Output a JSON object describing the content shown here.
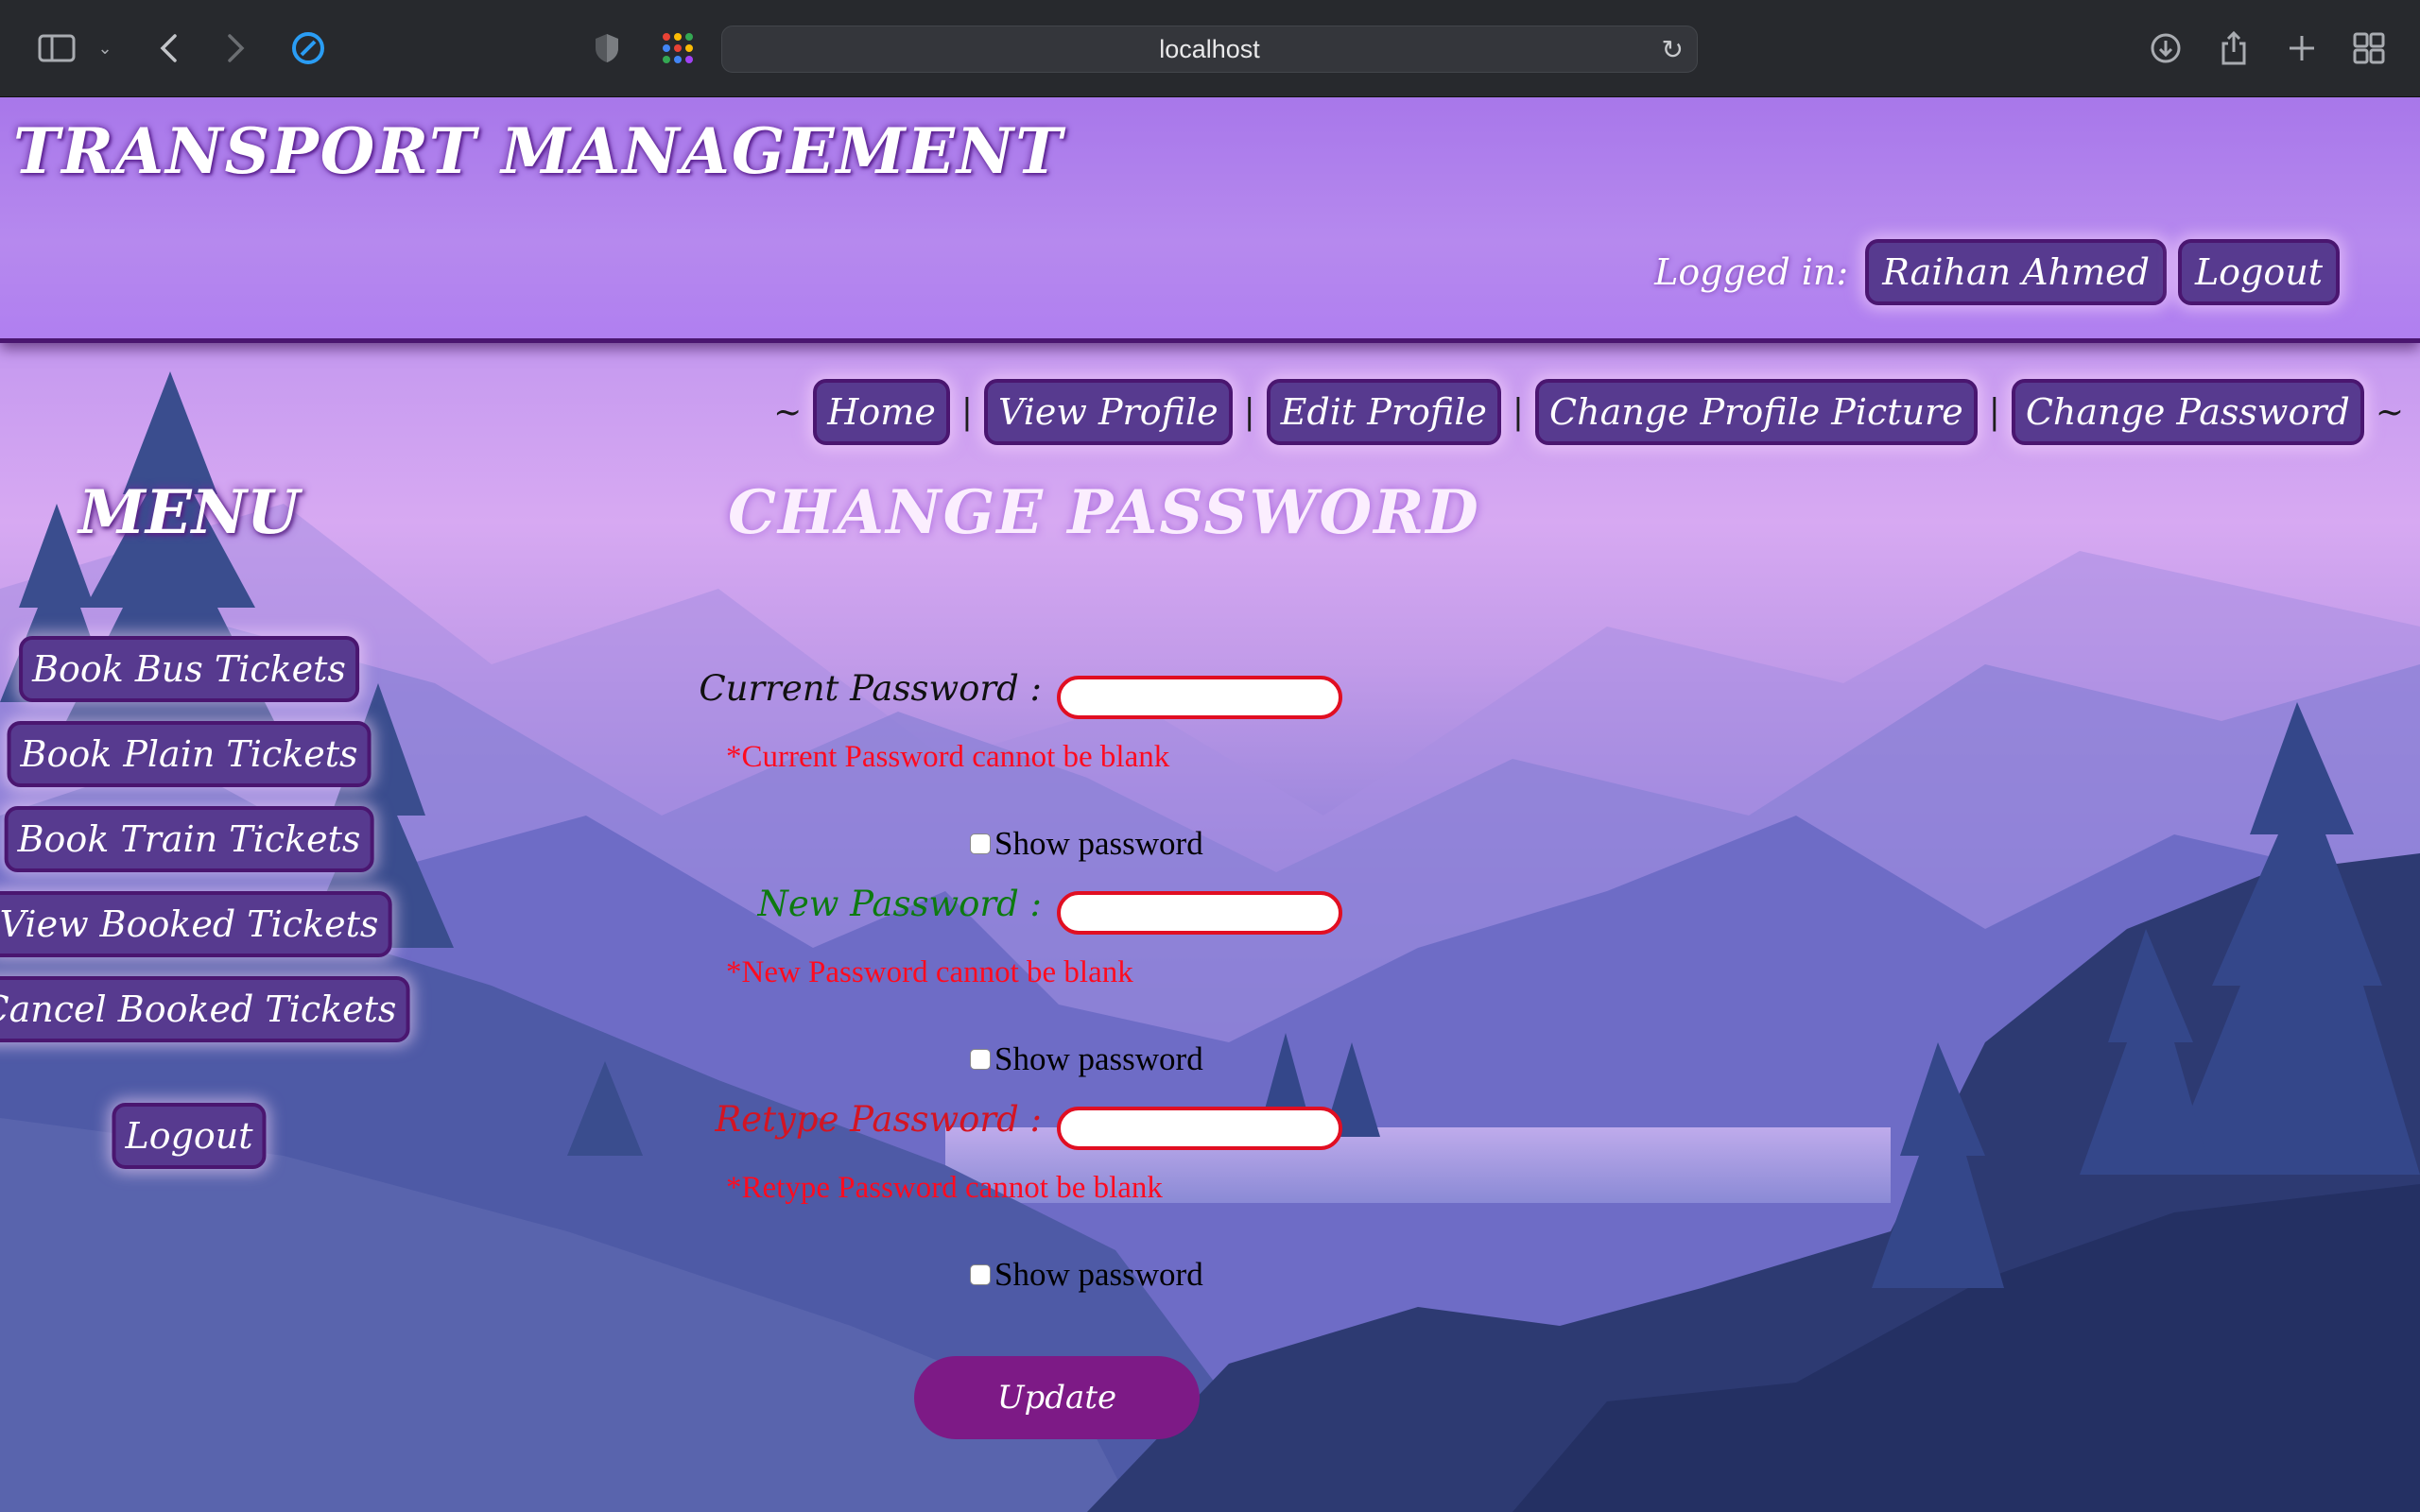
{
  "browser": {
    "url": "localhost"
  },
  "header": {
    "title": "TRANSPORT MANAGEMENT",
    "logged_in_label": "Logged in:",
    "user_name": "Raihan Ahmed",
    "logout_label": "Logout"
  },
  "topnav": {
    "tilde_left": "~",
    "tilde_right": "~",
    "separator": "|",
    "items": [
      {
        "label": "Home"
      },
      {
        "label": "View Profile"
      },
      {
        "label": "Edit Profile"
      },
      {
        "label": "Change Profile Picture"
      },
      {
        "label": "Change Password"
      }
    ]
  },
  "sidebar": {
    "title": "MENU",
    "items": [
      {
        "label": "Book Bus Tickets"
      },
      {
        "label": "Book Plain Tickets"
      },
      {
        "label": "Book Train Tickets"
      },
      {
        "label": "View Booked Tickets"
      },
      {
        "label": "Cancel Booked Tickets"
      }
    ],
    "logout_label": "Logout"
  },
  "form": {
    "title": "CHANGE PASSWORD",
    "fields": [
      {
        "label": "Current Password :",
        "label_color": "#111111",
        "value": "",
        "error": "*Current Password cannot be blank",
        "show_label": "Show password"
      },
      {
        "label": "New Password :",
        "label_color": "#0d7a10",
        "value": "",
        "error": "*New Password cannot be blank",
        "show_label": "Show password"
      },
      {
        "label": "Retype Password :",
        "label_color": "#d41422",
        "value": "",
        "error": "*Retype Password cannot be blank",
        "show_label": "Show password"
      }
    ],
    "submit_label": "Update"
  },
  "colors": {
    "accent": "#573a8f",
    "error": "#ff0b1f",
    "submit": "#7d1a86"
  }
}
